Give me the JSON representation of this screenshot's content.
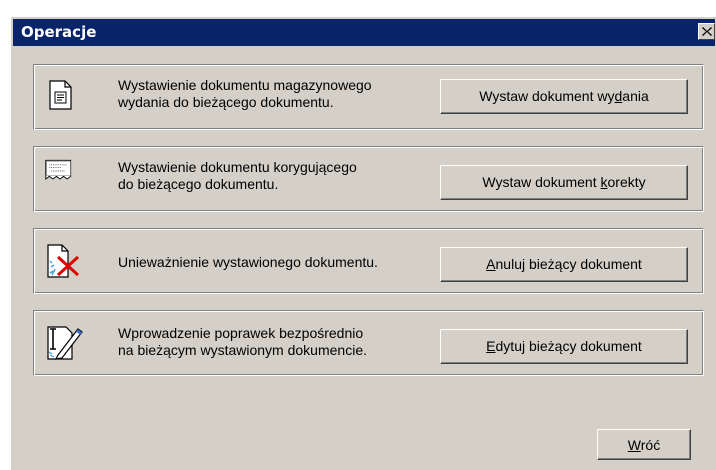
{
  "window": {
    "title": "Operacje",
    "close_icon": "close-x-icon"
  },
  "groups": [
    {
      "icon": "document-text-icon",
      "text": "Wystawienie dokumentu magazynowego\nwydania do bieżącego dokumentu.",
      "button": {
        "pre": "Wystaw dokument wy",
        "u": "d",
        "post": "ania"
      }
    },
    {
      "icon": "document-torn-icon",
      "text": "Wystawienie dokumentu korygującego\ndo bieżącego dokumentu.",
      "button": {
        "pre": "Wystaw dokument ",
        "u": "k",
        "post": "orekty"
      }
    },
    {
      "icon": "document-cancel-icon",
      "text": "Unieważnienie wystawionego dokumentu.",
      "button": {
        "pre": "",
        "u": "A",
        "post": "nuluj bieżący dokument"
      }
    },
    {
      "icon": "document-edit-icon",
      "text": "Wprowadzenie poprawek bezpośrednio\nna bieżącym wystawionym dokumencie.",
      "button": {
        "pre": "",
        "u": "E",
        "post": "dytuj bieżący dokument"
      }
    }
  ],
  "footer": {
    "back_button": {
      "pre": "",
      "u": "W",
      "post": "róć"
    }
  }
}
